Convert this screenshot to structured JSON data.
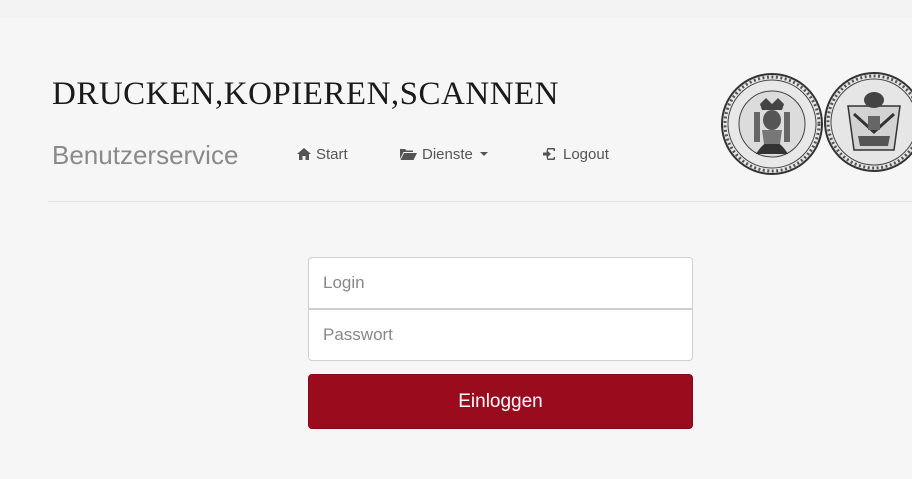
{
  "header": {
    "title": "DRUCKEN,KOPIEREN,SCANNEN",
    "brand": "Benutzerservice"
  },
  "nav": {
    "items": [
      {
        "label": "Start",
        "icon": "home-icon"
      },
      {
        "label": "Dienste",
        "icon": "folder-open-icon",
        "has_dropdown": true
      },
      {
        "label": "Logout",
        "icon": "sign-out-icon"
      }
    ]
  },
  "login_form": {
    "login_placeholder": "Login",
    "login_value": "",
    "password_placeholder": "Passwort",
    "password_value": "",
    "submit_label": "Einloggen"
  },
  "colors": {
    "accent": "#9a0b1e",
    "panel_background": "#f6f6f6",
    "nav_text": "#555555"
  }
}
